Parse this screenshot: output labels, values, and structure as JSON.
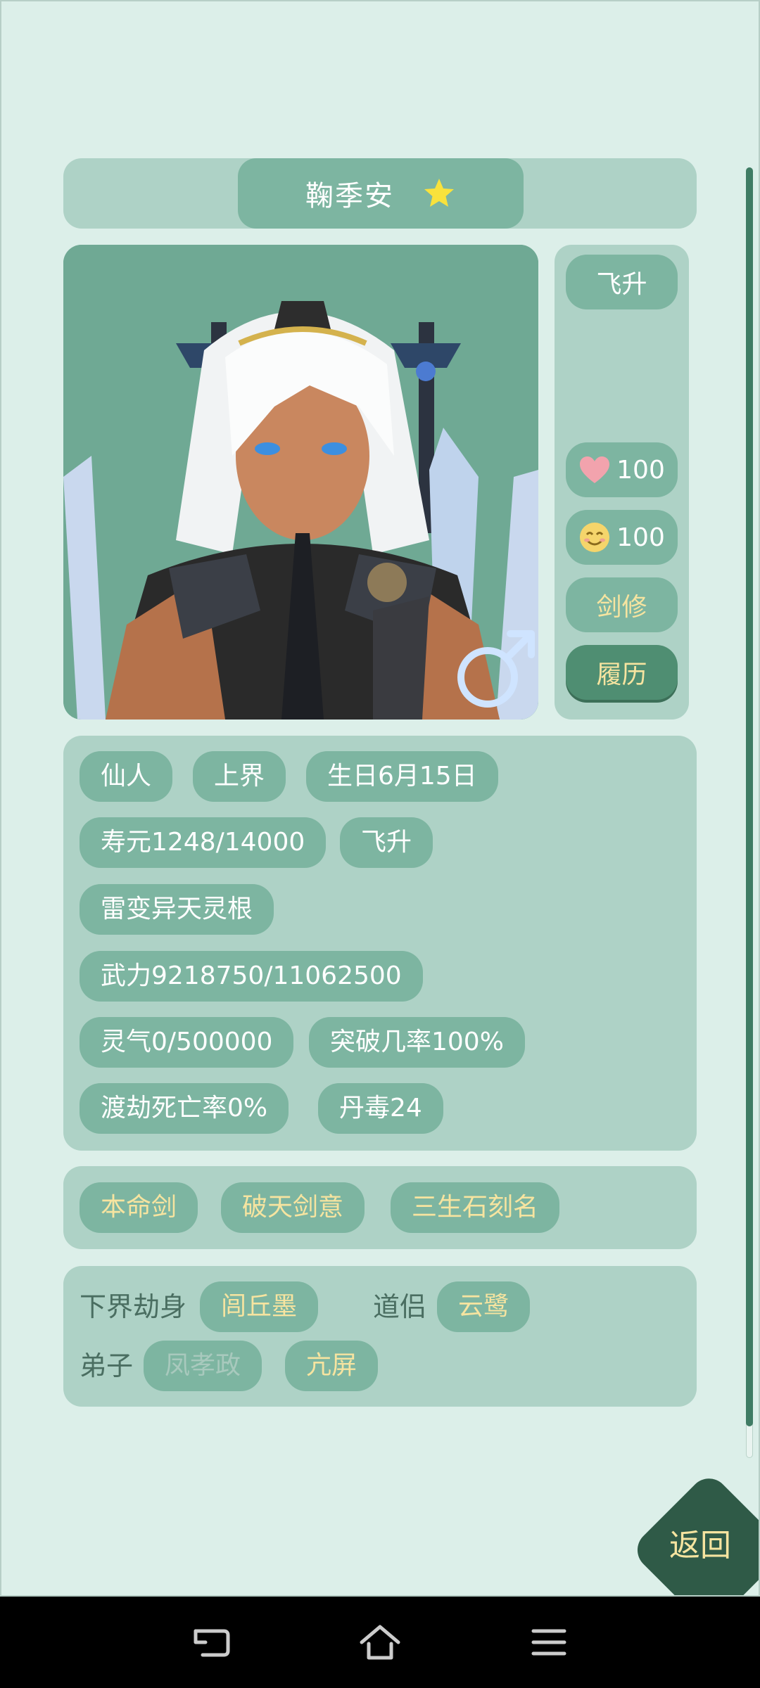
{
  "header": {
    "name": "鞠季安",
    "favorite_icon": "star-icon"
  },
  "portrait": {
    "gender_icon": "male-symbol-icon"
  },
  "side": {
    "stage_label": "飞升",
    "health": {
      "icon": "heart-icon",
      "value": "100"
    },
    "mood": {
      "icon": "smile-face-icon",
      "value": "100"
    },
    "class_label": "剑修",
    "history_label": "履历"
  },
  "attributes": {
    "row1": [
      "仙人",
      "上界",
      "生日6月15日"
    ],
    "row2": [
      "寿元1248/14000",
      "飞升"
    ],
    "row3": [
      "雷变异天灵根"
    ],
    "row4": [
      "武力9218750/11062500"
    ],
    "row5": [
      "灵气0/500000",
      "突破几率100%"
    ],
    "row6": [
      "渡劫死亡率0%",
      "丹毒24"
    ]
  },
  "skills": [
    "本命剑",
    "破天剑意",
    "三生石刻名"
  ],
  "relations": {
    "lower_realm_label": "下界劫身",
    "lower_realm_value": "闾丘墨",
    "partner_label": "道侣",
    "partner_value": "云鹭",
    "disciple_label": "弟子",
    "disciples": [
      "凤孝政",
      "亢屏"
    ]
  },
  "back_label": "返回",
  "colors": {
    "accent": "#7db5a1",
    "panel": "#aed2c6",
    "background": "#dcefe9",
    "gold_text": "#f6e4a0",
    "dark_green": "#2f5a47"
  }
}
